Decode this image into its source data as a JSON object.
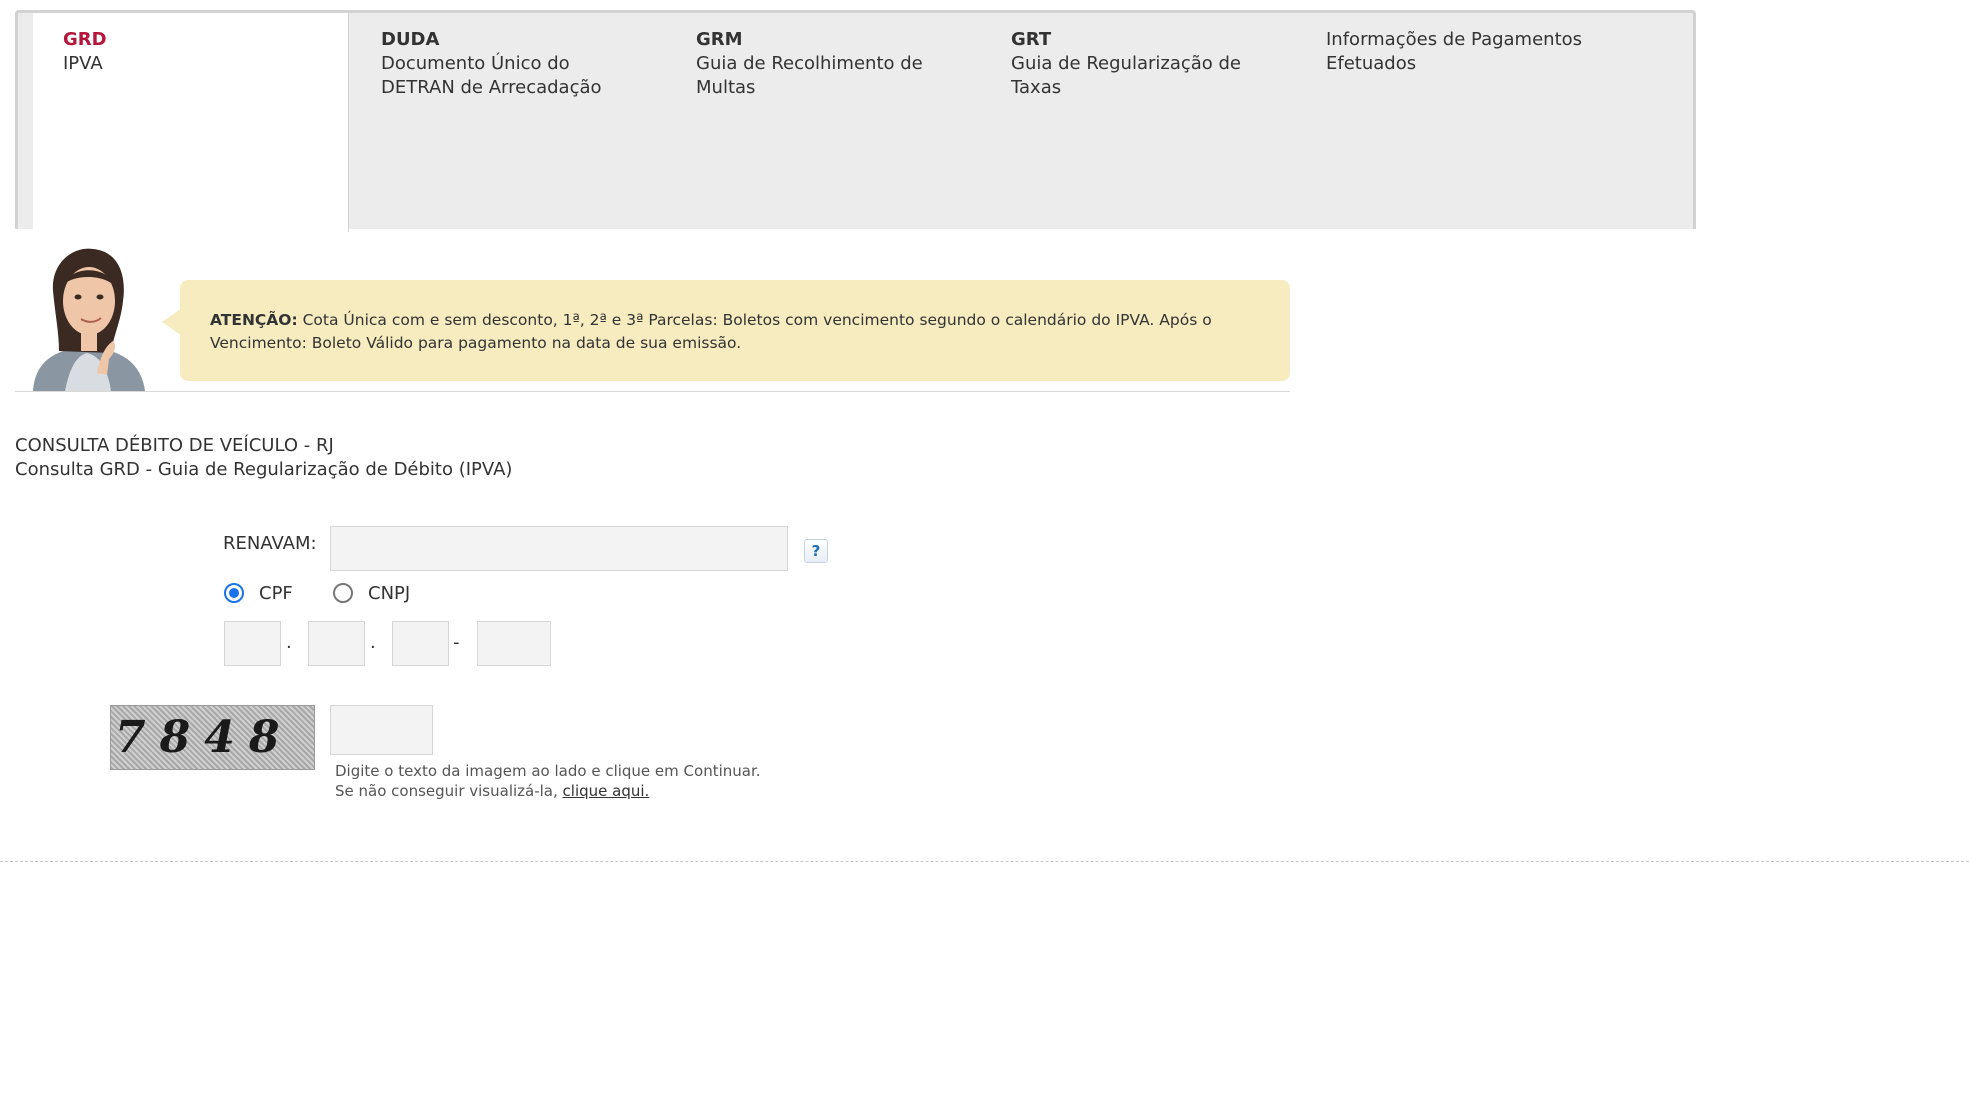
{
  "tabs": [
    {
      "code": "GRD",
      "desc": "IPVA"
    },
    {
      "code": "DUDA",
      "desc": "Documento Único do DETRAN de Arrecadação"
    },
    {
      "code": "GRM",
      "desc": "Guia de Recolhimento de Multas"
    },
    {
      "code": "GRT",
      "desc": "Guia de Regularização de Taxas"
    },
    {
      "code": "",
      "desc": "Informações de Pagamentos Efetuados"
    }
  ],
  "notice": {
    "label": "ATENÇÃO:",
    "text": " Cota Única com e sem desconto, 1ª, 2ª e 3ª Parcelas: Boletos com vencimento segundo o calendário do IPVA. Após o Vencimento: Boleto Válido para pagamento na data de sua emissão."
  },
  "page": {
    "title": "CONSULTA DÉBITO DE VEÍCULO - RJ",
    "subtitle": "Consulta GRD - Guia de Regularização de Débito (IPVA)"
  },
  "form": {
    "renavam_label": "RENAVAM:",
    "renavam_value": "",
    "help_label": "?",
    "doc_type_options": [
      "CPF",
      "CNPJ"
    ],
    "doc_type_selected": "CPF",
    "separators": [
      ".",
      ".",
      "-"
    ]
  },
  "captcha": {
    "image_text": "7848",
    "hint_line1": "Digite o texto da imagem ao lado e clique em Continuar.",
    "hint_line2": "Se não conseguir visualizá-la, ",
    "link_text": "clique aqui."
  },
  "colors": {
    "active_tab_code": "#b5163c",
    "notice_bg": "#f6ecbf",
    "radio_selected": "#1a73e8"
  }
}
